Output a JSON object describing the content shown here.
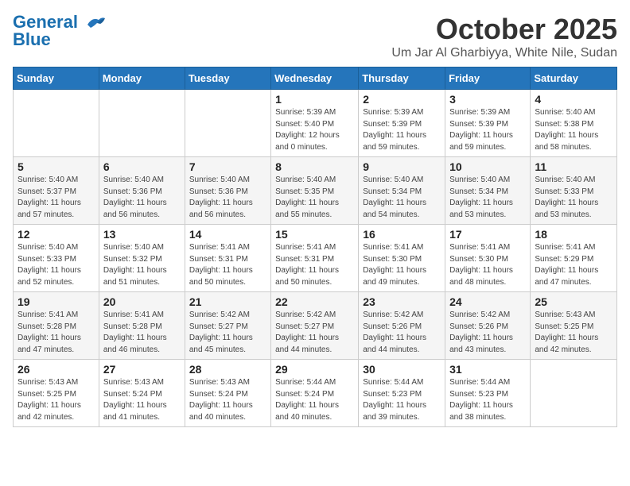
{
  "logo": {
    "line1": "General",
    "line2": "Blue"
  },
  "header": {
    "month": "October 2025",
    "location": "Um Jar Al Gharbiyya, White Nile, Sudan"
  },
  "weekdays": [
    "Sunday",
    "Monday",
    "Tuesday",
    "Wednesday",
    "Thursday",
    "Friday",
    "Saturday"
  ],
  "weeks": [
    [
      {
        "day": "",
        "info": ""
      },
      {
        "day": "",
        "info": ""
      },
      {
        "day": "",
        "info": ""
      },
      {
        "day": "1",
        "info": "Sunrise: 5:39 AM\nSunset: 5:40 PM\nDaylight: 12 hours\nand 0 minutes."
      },
      {
        "day": "2",
        "info": "Sunrise: 5:39 AM\nSunset: 5:39 PM\nDaylight: 11 hours\nand 59 minutes."
      },
      {
        "day": "3",
        "info": "Sunrise: 5:39 AM\nSunset: 5:39 PM\nDaylight: 11 hours\nand 59 minutes."
      },
      {
        "day": "4",
        "info": "Sunrise: 5:40 AM\nSunset: 5:38 PM\nDaylight: 11 hours\nand 58 minutes."
      }
    ],
    [
      {
        "day": "5",
        "info": "Sunrise: 5:40 AM\nSunset: 5:37 PM\nDaylight: 11 hours\nand 57 minutes."
      },
      {
        "day": "6",
        "info": "Sunrise: 5:40 AM\nSunset: 5:36 PM\nDaylight: 11 hours\nand 56 minutes."
      },
      {
        "day": "7",
        "info": "Sunrise: 5:40 AM\nSunset: 5:36 PM\nDaylight: 11 hours\nand 56 minutes."
      },
      {
        "day": "8",
        "info": "Sunrise: 5:40 AM\nSunset: 5:35 PM\nDaylight: 11 hours\nand 55 minutes."
      },
      {
        "day": "9",
        "info": "Sunrise: 5:40 AM\nSunset: 5:34 PM\nDaylight: 11 hours\nand 54 minutes."
      },
      {
        "day": "10",
        "info": "Sunrise: 5:40 AM\nSunset: 5:34 PM\nDaylight: 11 hours\nand 53 minutes."
      },
      {
        "day": "11",
        "info": "Sunrise: 5:40 AM\nSunset: 5:33 PM\nDaylight: 11 hours\nand 53 minutes."
      }
    ],
    [
      {
        "day": "12",
        "info": "Sunrise: 5:40 AM\nSunset: 5:33 PM\nDaylight: 11 hours\nand 52 minutes."
      },
      {
        "day": "13",
        "info": "Sunrise: 5:40 AM\nSunset: 5:32 PM\nDaylight: 11 hours\nand 51 minutes."
      },
      {
        "day": "14",
        "info": "Sunrise: 5:41 AM\nSunset: 5:31 PM\nDaylight: 11 hours\nand 50 minutes."
      },
      {
        "day": "15",
        "info": "Sunrise: 5:41 AM\nSunset: 5:31 PM\nDaylight: 11 hours\nand 50 minutes."
      },
      {
        "day": "16",
        "info": "Sunrise: 5:41 AM\nSunset: 5:30 PM\nDaylight: 11 hours\nand 49 minutes."
      },
      {
        "day": "17",
        "info": "Sunrise: 5:41 AM\nSunset: 5:30 PM\nDaylight: 11 hours\nand 48 minutes."
      },
      {
        "day": "18",
        "info": "Sunrise: 5:41 AM\nSunset: 5:29 PM\nDaylight: 11 hours\nand 47 minutes."
      }
    ],
    [
      {
        "day": "19",
        "info": "Sunrise: 5:41 AM\nSunset: 5:28 PM\nDaylight: 11 hours\nand 47 minutes."
      },
      {
        "day": "20",
        "info": "Sunrise: 5:41 AM\nSunset: 5:28 PM\nDaylight: 11 hours\nand 46 minutes."
      },
      {
        "day": "21",
        "info": "Sunrise: 5:42 AM\nSunset: 5:27 PM\nDaylight: 11 hours\nand 45 minutes."
      },
      {
        "day": "22",
        "info": "Sunrise: 5:42 AM\nSunset: 5:27 PM\nDaylight: 11 hours\nand 44 minutes."
      },
      {
        "day": "23",
        "info": "Sunrise: 5:42 AM\nSunset: 5:26 PM\nDaylight: 11 hours\nand 44 minutes."
      },
      {
        "day": "24",
        "info": "Sunrise: 5:42 AM\nSunset: 5:26 PM\nDaylight: 11 hours\nand 43 minutes."
      },
      {
        "day": "25",
        "info": "Sunrise: 5:43 AM\nSunset: 5:25 PM\nDaylight: 11 hours\nand 42 minutes."
      }
    ],
    [
      {
        "day": "26",
        "info": "Sunrise: 5:43 AM\nSunset: 5:25 PM\nDaylight: 11 hours\nand 42 minutes."
      },
      {
        "day": "27",
        "info": "Sunrise: 5:43 AM\nSunset: 5:24 PM\nDaylight: 11 hours\nand 41 minutes."
      },
      {
        "day": "28",
        "info": "Sunrise: 5:43 AM\nSunset: 5:24 PM\nDaylight: 11 hours\nand 40 minutes."
      },
      {
        "day": "29",
        "info": "Sunrise: 5:44 AM\nSunset: 5:24 PM\nDaylight: 11 hours\nand 40 minutes."
      },
      {
        "day": "30",
        "info": "Sunrise: 5:44 AM\nSunset: 5:23 PM\nDaylight: 11 hours\nand 39 minutes."
      },
      {
        "day": "31",
        "info": "Sunrise: 5:44 AM\nSunset: 5:23 PM\nDaylight: 11 hours\nand 38 minutes."
      },
      {
        "day": "",
        "info": ""
      }
    ]
  ]
}
